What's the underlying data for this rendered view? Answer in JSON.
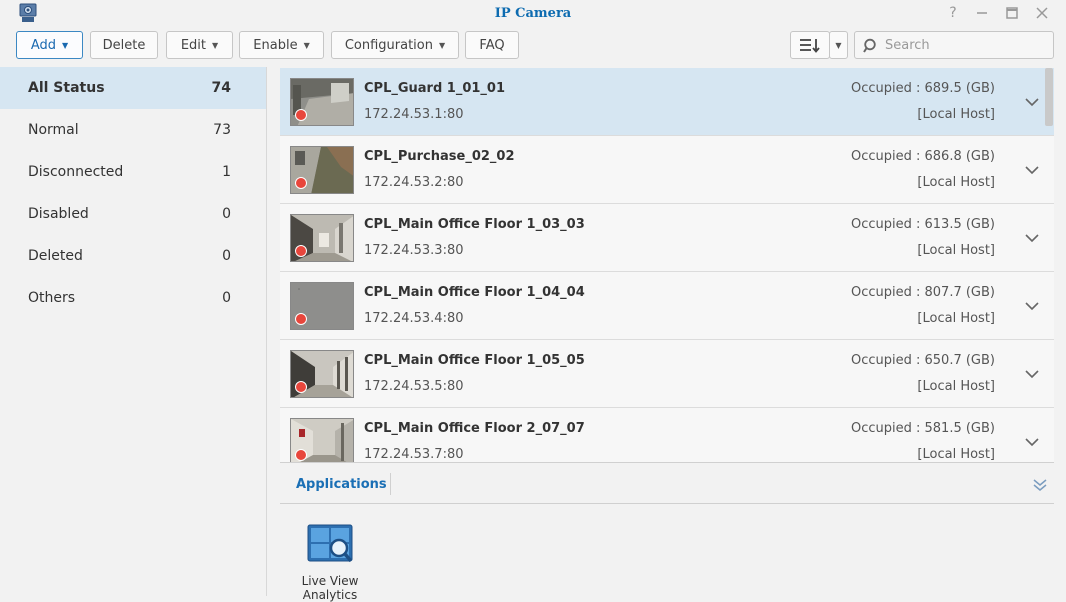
{
  "window": {
    "title": "IP Camera"
  },
  "toolbar": {
    "add": "Add",
    "delete": "Delete",
    "edit": "Edit",
    "enable": "Enable",
    "configuration": "Configuration",
    "faq": "FAQ",
    "search_placeholder": "Search"
  },
  "sidebar": {
    "items": [
      {
        "label": "All Status",
        "count": "74"
      },
      {
        "label": "Normal",
        "count": "73"
      },
      {
        "label": "Disconnected",
        "count": "1"
      },
      {
        "label": "Disabled",
        "count": "0"
      },
      {
        "label": "Deleted",
        "count": "0"
      },
      {
        "label": "Others",
        "count": "0"
      }
    ]
  },
  "cameras": [
    {
      "name": "CPL_Guard 1_01_01",
      "ip": "172.24.53.1:80",
      "occupied": "Occupied : 689.5 (GB)",
      "host": "[Local Host]"
    },
    {
      "name": "CPL_Purchase_02_02",
      "ip": "172.24.53.2:80",
      "occupied": "Occupied : 686.8 (GB)",
      "host": "[Local Host]"
    },
    {
      "name": "CPL_Main Office Floor 1_03_03",
      "ip": "172.24.53.3:80",
      "occupied": "Occupied : 613.5 (GB)",
      "host": "[Local Host]"
    },
    {
      "name": "CPL_Main Office Floor 1_04_04",
      "ip": "172.24.53.4:80",
      "occupied": "Occupied : 807.7 (GB)",
      "host": "[Local Host]"
    },
    {
      "name": "CPL_Main Office Floor 1_05_05",
      "ip": "172.24.53.5:80",
      "occupied": "Occupied : 650.7 (GB)",
      "host": "[Local Host]"
    },
    {
      "name": "CPL_Main Office Floor 2_07_07",
      "ip": "172.24.53.7:80",
      "occupied": "Occupied : 581.5 (GB)",
      "host": "[Local Host]"
    }
  ],
  "applications": {
    "tab": "Applications",
    "items": [
      {
        "name": "Live View Analytics"
      }
    ]
  },
  "colors": {
    "accent": "#1a6fb5",
    "selected_bg": "#d6e6f2",
    "record_dot": "#e8463c"
  }
}
